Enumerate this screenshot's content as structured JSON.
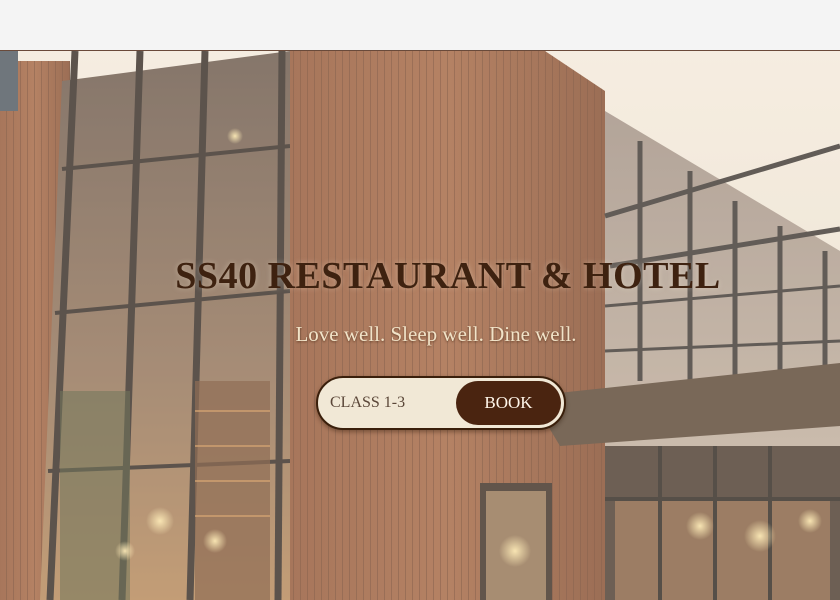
{
  "hero": {
    "title": "SS40 RESTAURANT & HOTEL",
    "subtitle": "Love well. Sleep well. Dine well."
  },
  "booking": {
    "class_placeholder": "CLASS 1-3",
    "book_label": "BOOK"
  },
  "colors": {
    "title": "#3e2210",
    "subtitle": "#f1e3c8",
    "button_bg": "#4a2410",
    "button_text": "#fff6ea",
    "input_bg": "#f1e8d6"
  }
}
